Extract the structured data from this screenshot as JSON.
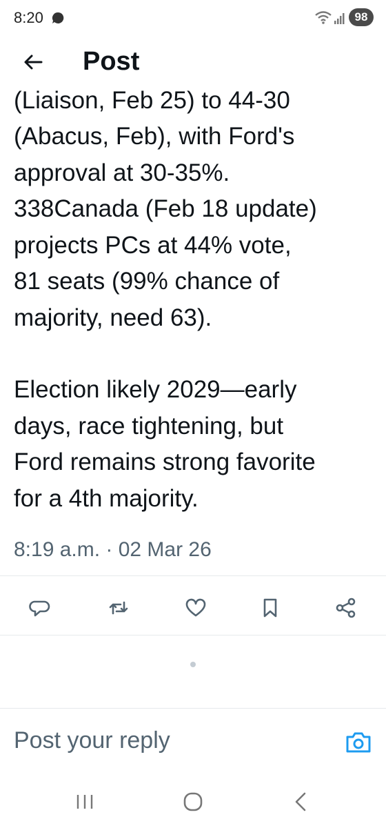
{
  "status_bar": {
    "time": "8:20",
    "battery": "98",
    "chat_icon": "chat-bubble-icon",
    "wifi_icon": "wifi-icon",
    "signal_icon": "signal-icon"
  },
  "header": {
    "title": "Post",
    "back_icon": "arrow-left-icon"
  },
  "post": {
    "lines_para1": [
      "(Liaison, Feb 25) to 44-30",
      "(Abacus, Feb), with Ford's",
      "approval at 30-35%.",
      "338Canada (Feb 18 update)",
      "projects PCs at 44% vote,",
      "81 seats (99% chance of",
      "majority, need 63)."
    ],
    "lines_para2": [
      "Election likely 2029—early",
      "days, race tightening, but",
      "Ford remains strong favorite",
      "for a 4th majority."
    ],
    "timestamp": "8:19 a.m. · 02 Mar 26"
  },
  "actions": {
    "icons": [
      "reply-icon",
      "repost-icon",
      "like-icon",
      "bookmark-icon",
      "share-icon"
    ],
    "color": "#536471"
  },
  "reply": {
    "placeholder": "Post your reply",
    "camera_icon": "camera-icon",
    "accent": "#1d9bf0"
  },
  "nav_bar": {
    "icons": [
      "recents-icon",
      "home-icon",
      "back-icon"
    ]
  }
}
